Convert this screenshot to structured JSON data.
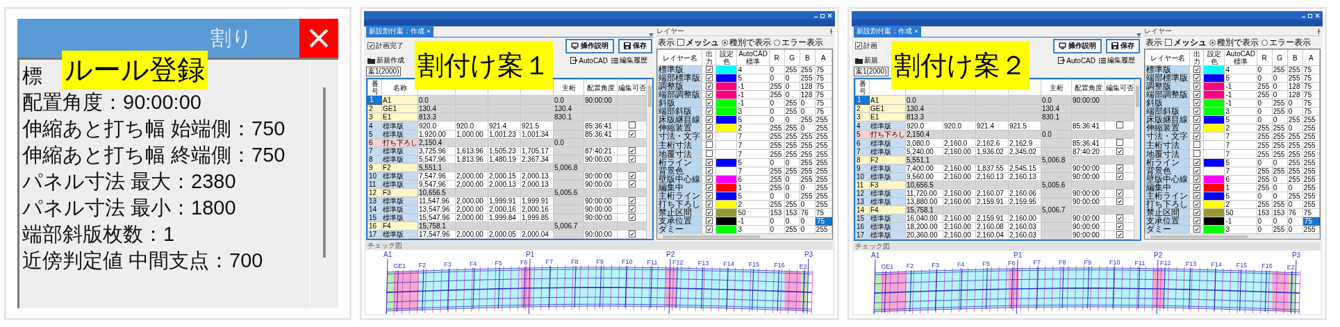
{
  "rule_dialog": {
    "label": "ルール登録",
    "title": "割り",
    "lines": [
      "標",
      "配置角度：90:00:00",
      "伸縮あと打ち幅 始端側：750",
      "伸縮あと打ち幅 終端側：750",
      "パネル寸法 最大：2380",
      "パネル寸法 最小：1800",
      "端部斜版枚数：1",
      "近傍判定値 中間支点：700"
    ]
  },
  "plans": [
    {
      "label": "割付け案１",
      "tab": "新設割付案：作成",
      "plan_complete": {
        "label": "計画完了",
        "checked": true
      },
      "new_button": "新規作成",
      "autocad_button": "AutoCAD",
      "history_button": "編集履歴",
      "help_button": "操作説明",
      "save_button": "保存",
      "plan_select": "案1(2000)",
      "table": {
        "columns": [
          {
            "label": "番号"
          },
          {
            "label": "名称"
          },
          {},
          {},
          {},
          {},
          {
            "label": "主桁"
          },
          {
            "label": "配置角度"
          },
          {
            "label": "編集可否"
          }
        ],
        "rows": [
          {
            "kind": "joint",
            "selected": true,
            "no": "1",
            "name": "A1",
            "column_3": "0.0",
            "column_7": "0.0",
            "column_8": "90:00:00"
          },
          {
            "kind": "joint",
            "selected": false,
            "no": "2",
            "name": "GE1",
            "column_3": "130.4",
            "column_7": "130.4"
          },
          {
            "kind": "joint",
            "selected": false,
            "no": "3",
            "name": "E1",
            "column_3": "813.3",
            "column_7": "830.1"
          },
          {
            "kind": "panel",
            "selected": false,
            "checked": false,
            "no": "4",
            "name": "標準版",
            "column_3": "920.0",
            "column_4": "920.0",
            "column_5": "921.4",
            "column_6": "921.5",
            "column_8": "85:36:41"
          },
          {
            "kind": "panel",
            "selected": false,
            "checked": true,
            "no": "5",
            "name": "標準版",
            "column_3": "1,920.00",
            "column_4": "1,000.00",
            "column_5": "1,001.23",
            "column_6": "1,001.34",
            "column_8": "85:36:41"
          },
          {
            "kind": "drop",
            "selected": false,
            "no": "6",
            "name": "打ち下ろし",
            "column_3": "2,150.4",
            "column_7": "0.0"
          },
          {
            "kind": "panel",
            "selected": false,
            "checked": true,
            "no": "7",
            "name": "標準版",
            "column_3": "3,725.96",
            "column_4": "1,613.96",
            "column_5": "1,505.23",
            "column_6": "1,705.17",
            "column_8": "87:40:21"
          },
          {
            "kind": "panel",
            "selected": false,
            "checked": true,
            "no": "8",
            "name": "標準版",
            "column_3": "5,547.96",
            "column_4": "1,813.96",
            "column_5": "1,480.19",
            "column_6": "2,367.34",
            "column_8": "90:00:00"
          },
          {
            "kind": "joint",
            "selected": false,
            "no": "9",
            "name": "F2",
            "column_3": "5,551.1",
            "column_7": "5,006.8"
          },
          {
            "kind": "panel",
            "selected": false,
            "checked": true,
            "no": "10",
            "name": "標準版",
            "column_3": "7,547.96",
            "column_4": "2,000.00",
            "column_5": "2,000.15",
            "column_6": "2,000.13",
            "column_8": "90:00:00"
          },
          {
            "kind": "panel",
            "selected": false,
            "checked": true,
            "no": "11",
            "name": "標準版",
            "column_3": "9,547.96",
            "column_4": "2,000.00",
            "column_5": "2,000.13",
            "column_6": "2,000.13",
            "column_8": "90:00:00"
          },
          {
            "kind": "joint",
            "selected": false,
            "no": "12",
            "name": "F3",
            "column_3": "10,656.5",
            "column_7": "5,005.6"
          },
          {
            "kind": "panel",
            "selected": false,
            "checked": true,
            "no": "13",
            "name": "標準版",
            "column_3": "11,547.96",
            "column_4": "2,000.00",
            "column_5": "1,999.91",
            "column_6": "1,999.91",
            "column_8": "90:00:00"
          },
          {
            "kind": "panel",
            "selected": false,
            "checked": true,
            "no": "14",
            "name": "標準版",
            "column_3": "13,547.96",
            "column_4": "2,000.00",
            "column_5": "2,000.16",
            "column_6": "2,000.16",
            "column_8": "90:00:00"
          },
          {
            "kind": "panel",
            "selected": false,
            "checked": true,
            "no": "15",
            "name": "標準版",
            "column_3": "15,547.96",
            "column_4": "2,000.00",
            "column_5": "1,999.84",
            "column_6": "1,999.85",
            "column_8": "90:00:00"
          },
          {
            "kind": "joint",
            "selected": false,
            "no": "16",
            "name": "F4",
            "column_3": "15,758.1",
            "column_7": "5,006.7"
          },
          {
            "kind": "panel",
            "selected": false,
            "checked": true,
            "no": "17",
            "name": "標準版",
            "column_3": "17,547.96",
            "column_4": "2,000.00",
            "column_5": "2,000.05",
            "column_6": "2,000.04",
            "column_8": "90:00:00"
          }
        ]
      },
      "layers": {
        "title": "レイヤー",
        "display_label": "表示",
        "mesh": {
          "label": "メッシュ",
          "checked": false
        },
        "view_modes": [
          {
            "label": "種別で表示",
            "selected": true
          },
          {
            "label": "エラー表示",
            "selected": false
          }
        ],
        "columns": [
          "レイヤー名",
          "出力",
          "設定色",
          "AutoCAD標準",
          "R",
          "G",
          "B",
          "A"
        ],
        "rows": [
          {
            "name": "標準版",
            "output": true,
            "color": "#00ffff",
            "cad": "4",
            "r": "0",
            "g": "255",
            "b": "255",
            "a": "75",
            "selected": false
          },
          {
            "name": "端部標準版",
            "output": true,
            "color": "#0000ff",
            "cad": "5",
            "r": "0",
            "g": "0",
            "b": "255",
            "a": "75",
            "selected": false
          },
          {
            "name": "調整版",
            "output": true,
            "color": "#ff0080",
            "cad": "-1",
            "r": "255",
            "g": "0",
            "b": "128",
            "a": "75",
            "selected": false
          },
          {
            "name": "端部調整版",
            "output": true,
            "color": "#ff0080",
            "cad": "-1",
            "r": "255",
            "g": "0",
            "b": "128",
            "a": "75",
            "selected": false
          },
          {
            "name": "斜版",
            "output": true,
            "color": "#00ff00",
            "cad": "-1",
            "r": "0",
            "g": "255",
            "b": "0",
            "a": "75",
            "selected": false
          },
          {
            "name": "端部斜版",
            "output": true,
            "color": "#00ff00",
            "cad": "3",
            "r": "0",
            "g": "255",
            "b": "0",
            "a": "75",
            "selected": false
          },
          {
            "name": "床版継目線",
            "output": true,
            "color": "#0000ff",
            "cad": "5",
            "r": "0",
            "g": "0",
            "b": "255",
            "a": "255",
            "selected": false
          },
          {
            "name": "伸縮装置",
            "output": true,
            "color": "#ffff00",
            "cad": "2",
            "r": "255",
            "g": "255",
            "b": "0",
            "a": "255",
            "selected": false
          },
          {
            "name": "寸法・文字",
            "output": true,
            "color": "#ffffff",
            "cad": "7",
            "r": "255",
            "g": "255",
            "b": "255",
            "a": "255",
            "selected": false
          },
          {
            "name": "主桁寸法",
            "output": false,
            "color": "#ffffff",
            "cad": "7",
            "r": "255",
            "g": "255",
            "b": "255",
            "a": "255",
            "selected": false
          },
          {
            "name": "地覆寸法",
            "output": false,
            "color": "#ffffff",
            "cad": "7",
            "r": "255",
            "g": "255",
            "b": "255",
            "a": "255",
            "selected": false
          },
          {
            "name": "桁ライン",
            "output": true,
            "color": "#0000ff",
            "cad": "5",
            "r": "0",
            "g": "0",
            "b": "255",
            "a": "255",
            "selected": false
          },
          {
            "name": "背景色",
            "output": true,
            "color": "#ffffff",
            "cad": "7",
            "r": "255",
            "g": "255",
            "b": "255",
            "a": "255",
            "selected": false
          },
          {
            "name": "壁版中心線",
            "output": true,
            "color": "#ff00ff",
            "cad": "6",
            "r": "255",
            "g": "0",
            "b": "255",
            "a": "255",
            "selected": false
          },
          {
            "name": "編集中",
            "output": true,
            "color": "#ff0000",
            "cad": "1",
            "r": "255",
            "g": "0",
            "b": "0",
            "a": "255",
            "selected": false
          },
          {
            "name": "主桁ライン",
            "output": true,
            "color": "#0000ff",
            "cad": "5",
            "r": "0",
            "g": "0",
            "b": "255",
            "a": "255",
            "selected": false
          },
          {
            "name": "打ち下ろし",
            "output": true,
            "color": "#ffff00",
            "cad": "2",
            "r": "255",
            "g": "255",
            "b": "0",
            "a": "255",
            "selected": false
          },
          {
            "name": "禁止区間",
            "output": true,
            "color": "#999933",
            "cad": "50",
            "r": "153",
            "g": "153",
            "b": "76",
            "a": "75",
            "selected": false
          },
          {
            "name": "支承位置",
            "output": true,
            "color": "#000000",
            "cad": "-1",
            "r": "0",
            "g": "0",
            "b": "0",
            "a": "75",
            "selected": true
          },
          {
            "name": "ダミー",
            "output": true,
            "color": "#00ff00",
            "cad": "3",
            "r": "0",
            "g": "255",
            "b": "0",
            "a": "255",
            "selected": false
          }
        ]
      },
      "check_view": {
        "title": "チェック図",
        "supports": [
          "A1",
          "P1",
          "P2",
          "P3"
        ],
        "joints": [
          "GE1",
          "F2",
          "F3",
          "F4",
          "F5",
          "F6",
          "F7",
          "F8",
          "F9",
          "F10",
          "F11",
          "F12",
          "F13",
          "F14",
          "F15",
          "F16",
          "E2"
        ]
      }
    },
    {
      "label": "割付け案２",
      "tab": "新設割付案：作成",
      "plan_complete": {
        "label": "計画",
        "checked": true
      },
      "new_button": "新規",
      "autocad_button": "AutoCAD",
      "history_button": "編集履歴",
      "help_button": "操作説明",
      "save_button": "保存",
      "plan_select": "案1(2000)",
      "table": {
        "columns": [
          {
            "label": "番号"
          },
          {},
          {},
          {},
          {},
          {},
          {
            "label": "主桁"
          },
          {
            "label": "配置角度"
          },
          {
            "label": "編集可否"
          }
        ],
        "rows": [
          {
            "kind": "joint",
            "selected": true,
            "no": "1",
            "name": "A1",
            "column_3": "0.0",
            "column_7": "0.0",
            "column_8": "90:00:00"
          },
          {
            "kind": "joint",
            "selected": false,
            "no": "2",
            "name": "GE1",
            "column_3": "130.4",
            "column_7": "130.4"
          },
          {
            "kind": "joint",
            "selected": false,
            "no": "3",
            "name": "E1",
            "column_3": "813.3",
            "column_7": "830.1"
          },
          {
            "kind": "panel",
            "selected": false,
            "checked": false,
            "no": "4",
            "name": "標準版",
            "column_3": "920.0",
            "column_4": "920.0",
            "column_5": "921.4",
            "column_6": "921.5",
            "column_8": "85:36:41"
          },
          {
            "kind": "drop",
            "selected": false,
            "no": "5",
            "name": "打ち下ろし",
            "column_3": "2,150.4",
            "column_7": "0.0"
          },
          {
            "kind": "panel",
            "selected": false,
            "checked": false,
            "no": "6",
            "name": "標準版",
            "column_3": "3,080.0",
            "column_4": "2,160.0",
            "column_5": "2,162.6",
            "column_6": "2,162.9",
            "column_8": "85:36:41"
          },
          {
            "kind": "panel",
            "selected": false,
            "checked": true,
            "no": "7",
            "name": "標準版",
            "column_3": "5,240.00",
            "column_4": "2,160.00",
            "column_5": "1,936.02",
            "column_6": "2,345.02",
            "column_8": "87:40:20"
          },
          {
            "kind": "joint",
            "selected": false,
            "no": "8",
            "name": "F2",
            "column_3": "5,551.1",
            "column_7": "5,006.8"
          },
          {
            "kind": "panel",
            "selected": false,
            "checked": true,
            "no": "9",
            "name": "標準版",
            "column_3": "7,400.00",
            "column_4": "2,160.00",
            "column_5": "1,837.55",
            "column_6": "2,545.15",
            "column_8": "90:00:00"
          },
          {
            "kind": "panel",
            "selected": false,
            "checked": true,
            "no": "10",
            "name": "標準版",
            "column_3": "9,560.00",
            "column_4": "2,160.00",
            "column_5": "2,160.13",
            "column_6": "2,160.13",
            "column_8": "90:00:00"
          },
          {
            "kind": "joint",
            "selected": false,
            "no": "11",
            "name": "F3",
            "column_3": "10,656.5",
            "column_7": "5,005.6"
          },
          {
            "kind": "panel",
            "selected": false,
            "checked": true,
            "no": "12",
            "name": "標準版",
            "column_3": "11,720.00",
            "column_4": "2,160.00",
            "column_5": "2,160.07",
            "column_6": "2,160.06",
            "column_8": "90:00:00"
          },
          {
            "kind": "panel",
            "selected": false,
            "checked": true,
            "no": "13",
            "name": "標準版",
            "column_3": "13,880.00",
            "column_4": "2,160.00",
            "column_5": "2,159.91",
            "column_6": "2,159.95",
            "column_8": "90:00:00"
          },
          {
            "kind": "joint",
            "selected": false,
            "no": "14",
            "name": "F4",
            "column_3": "15,758.1",
            "column_7": "5,006.7"
          },
          {
            "kind": "panel",
            "selected": false,
            "checked": true,
            "no": "15",
            "name": "標準版",
            "column_3": "16,040.00",
            "column_4": "2,160.00",
            "column_5": "2,159.91",
            "column_6": "2,160.00",
            "column_8": "90:00:00"
          },
          {
            "kind": "panel",
            "selected": false,
            "checked": true,
            "no": "16",
            "name": "標準版",
            "column_3": "18,200.00",
            "column_4": "2,160.00",
            "column_5": "2,160.08",
            "column_6": "2,160.03",
            "column_8": "90:00:00"
          },
          {
            "kind": "panel",
            "selected": false,
            "checked": true,
            "no": "17",
            "name": "標準版",
            "column_3": "20,360.00",
            "column_4": "2,160.00",
            "column_5": "2,160.04",
            "column_6": "2,160.03",
            "column_8": "90:00:00"
          }
        ]
      },
      "layers": {
        "title": "レイヤー",
        "display_label": "表示",
        "mesh": {
          "label": "メッシュ",
          "checked": false
        },
        "view_modes": [
          {
            "label": "種別で表示",
            "selected": true
          },
          {
            "label": "エラー表示",
            "selected": false
          }
        ],
        "columns": [
          "レイヤー名",
          "出力",
          "設定色",
          "AutoCAD標準",
          "R",
          "G",
          "B",
          "A"
        ],
        "rows": [
          {
            "name": "標準版",
            "output": true,
            "color": "#00ffff",
            "cad": "4",
            "r": "0",
            "g": "255",
            "b": "255",
            "a": "75",
            "selected": false
          },
          {
            "name": "端部標準版",
            "output": true,
            "color": "#0000ff",
            "cad": "5",
            "r": "0",
            "g": "0",
            "b": "255",
            "a": "75",
            "selected": false
          },
          {
            "name": "調整版",
            "output": true,
            "color": "#ff0080",
            "cad": "-1",
            "r": "255",
            "g": "0",
            "b": "128",
            "a": "75",
            "selected": false
          },
          {
            "name": "端部調整版",
            "output": true,
            "color": "#ff0080",
            "cad": "-1",
            "r": "255",
            "g": "0",
            "b": "128",
            "a": "75",
            "selected": false
          },
          {
            "name": "斜版",
            "output": true,
            "color": "#00ff00",
            "cad": "-1",
            "r": "0",
            "g": "255",
            "b": "0",
            "a": "75",
            "selected": false
          },
          {
            "name": "端部斜版",
            "output": true,
            "color": "#00ff00",
            "cad": "3",
            "r": "0",
            "g": "255",
            "b": "0",
            "a": "75",
            "selected": false
          },
          {
            "name": "床版継目線",
            "output": true,
            "color": "#0000ff",
            "cad": "5",
            "r": "0",
            "g": "0",
            "b": "255",
            "a": "255",
            "selected": false
          },
          {
            "name": "伸縮装置",
            "output": true,
            "color": "#ffff00",
            "cad": "2",
            "r": "255",
            "g": "255",
            "b": "0",
            "a": "255",
            "selected": false
          },
          {
            "name": "寸法・文字",
            "output": true,
            "color": "#ffffff",
            "cad": "7",
            "r": "255",
            "g": "255",
            "b": "255",
            "a": "255",
            "selected": false
          },
          {
            "name": "主桁寸法",
            "output": false,
            "color": "#ffffff",
            "cad": "7",
            "r": "255",
            "g": "255",
            "b": "255",
            "a": "255",
            "selected": false
          },
          {
            "name": "地覆寸法",
            "output": false,
            "color": "#ffffff",
            "cad": "7",
            "r": "255",
            "g": "255",
            "b": "255",
            "a": "255",
            "selected": false
          },
          {
            "name": "桁ライン",
            "output": true,
            "color": "#0000ff",
            "cad": "5",
            "r": "0",
            "g": "0",
            "b": "255",
            "a": "255",
            "selected": false
          },
          {
            "name": "背景色",
            "output": true,
            "color": "#ffffff",
            "cad": "7",
            "r": "255",
            "g": "255",
            "b": "255",
            "a": "255",
            "selected": false
          },
          {
            "name": "壁版中心線",
            "output": true,
            "color": "#ff00ff",
            "cad": "6",
            "r": "255",
            "g": "0",
            "b": "255",
            "a": "255",
            "selected": false
          },
          {
            "name": "編集中",
            "output": true,
            "color": "#ff0000",
            "cad": "1",
            "r": "255",
            "g": "0",
            "b": "0",
            "a": "255",
            "selected": false
          },
          {
            "name": "主桁ライン",
            "output": true,
            "color": "#0000ff",
            "cad": "5",
            "r": "0",
            "g": "0",
            "b": "255",
            "a": "255",
            "selected": false
          },
          {
            "name": "打ち下ろし",
            "output": true,
            "color": "#ffff00",
            "cad": "2",
            "r": "255",
            "g": "255",
            "b": "0",
            "a": "255",
            "selected": false
          },
          {
            "name": "禁止区間",
            "output": true,
            "color": "#999933",
            "cad": "50",
            "r": "153",
            "g": "153",
            "b": "76",
            "a": "75",
            "selected": false
          },
          {
            "name": "支承位置",
            "output": true,
            "color": "#000000",
            "cad": "-1",
            "r": "0",
            "g": "0",
            "b": "0",
            "a": "75",
            "selected": true
          },
          {
            "name": "ダミー",
            "output": true,
            "color": "#00ff00",
            "cad": "3",
            "r": "0",
            "g": "255",
            "b": "0",
            "a": "255",
            "selected": false
          }
        ]
      },
      "check_view": {
        "title": "チェック図",
        "supports": [
          "A1",
          "P1",
          "P2",
          "P3"
        ],
        "joints": [
          "GE1",
          "F2",
          "F3",
          "F4",
          "F5",
          "F6",
          "F7",
          "F8",
          "F9",
          "F10",
          "F11",
          "F12",
          "F13",
          "F14",
          "F15",
          "F16",
          "E2"
        ]
      }
    }
  ]
}
